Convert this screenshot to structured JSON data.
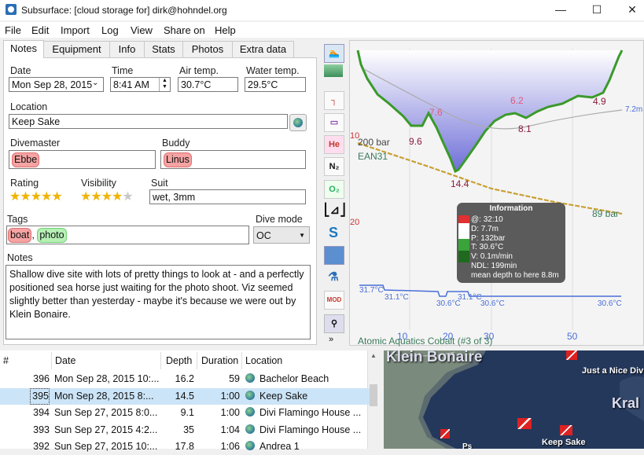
{
  "window": {
    "title": "Subsurface: [cloud storage for] dirk@hohndel.org",
    "minimize": "—",
    "maximize": "☐",
    "close": "✕"
  },
  "menu": [
    "File",
    "Edit",
    "Import",
    "Log",
    "View",
    "Share on",
    "Help"
  ],
  "tabs": [
    "Notes",
    "Equipment",
    "Info",
    "Stats",
    "Photos",
    "Extra data"
  ],
  "notes": {
    "date_label": "Date",
    "date_value": "Mon Sep 28, 2015",
    "time_label": "Time",
    "time_value": "8:41 AM",
    "air_label": "Air temp.",
    "air_value": "30.7°C",
    "water_label": "Water temp.",
    "water_value": "29.5°C",
    "location_label": "Location",
    "location_value": "Keep Sake",
    "divemaster_label": "Divemaster",
    "divemaster_value": "Ebbe",
    "buddy_label": "Buddy",
    "buddy_value": "Linus",
    "rating_label": "Rating",
    "rating": 5,
    "visibility_label": "Visibility",
    "visibility": 4,
    "suit_label": "Suit",
    "suit_value": "wet, 3mm",
    "tags_label": "Tags",
    "tags": [
      "boat",
      "photo"
    ],
    "divemode_label": "Dive mode",
    "divemode_value": "OC",
    "notes_label": "Notes",
    "notes_text": "Shallow dive site with lots of pretty things to look at - and a perfectly positioned sea horse just waiting for the photo shoot. Viz seemed slightly better than yesterday - maybe it's because we were out by Klein Bonaire."
  },
  "toolbar": [
    "He",
    "N₂",
    "O₂",
    "MOD"
  ],
  "profile": {
    "depth_labels": [
      "7.6",
      "9.6",
      "14.4",
      "6.2",
      "8.1",
      "4.9",
      "7.2m"
    ],
    "pressure_start": "200 bar",
    "gas": "EAN31",
    "pressure_end": "89 bar",
    "axis_y": [
      "10",
      "20"
    ],
    "axis_x": [
      "10",
      "20",
      "30",
      "50"
    ],
    "temps": [
      "31.7°C",
      "31.1°C",
      "30.6°C",
      "31.1°C",
      "30.6°C",
      "30.6°C"
    ],
    "computer": "Atomic Aquatics Cobalt (#3 of 3)",
    "info": {
      "title": "Information",
      "lines": [
        "@: 32:10",
        "D: 7.7m",
        "P: 132bar",
        "T: 30.6°C",
        "V: 0.1m/min",
        "NDL: 199min",
        "mean depth to here 8.8m"
      ]
    }
  },
  "divelist": {
    "headers": [
      "#",
      "Date",
      "Depth",
      "Duration",
      "Location"
    ],
    "rows": [
      [
        "396",
        "Mon Sep 28, 2015 10:...",
        "16.2",
        "59",
        "Bachelor Beach"
      ],
      [
        "395",
        "Mon Sep 28, 2015 8:...",
        "14.5",
        "1:00",
        "Keep Sake"
      ],
      [
        "394",
        "Sun Sep 27, 2015 8:0...",
        "9.1",
        "1:00",
        "Divi Flamingo House ..."
      ],
      [
        "393",
        "Sun Sep 27, 2015 4:2...",
        "35",
        "1:04",
        "Divi Flamingo House ..."
      ],
      [
        "392",
        "Sun Sep 27, 2015 10:...",
        "17.8",
        "1:06",
        "Andrea 1"
      ]
    ],
    "selected_index": 1
  },
  "map": {
    "labels": [
      "Klein Bonaire",
      "Just a Nice Div",
      "Kral",
      "Keep Sake",
      "Ps"
    ]
  }
}
